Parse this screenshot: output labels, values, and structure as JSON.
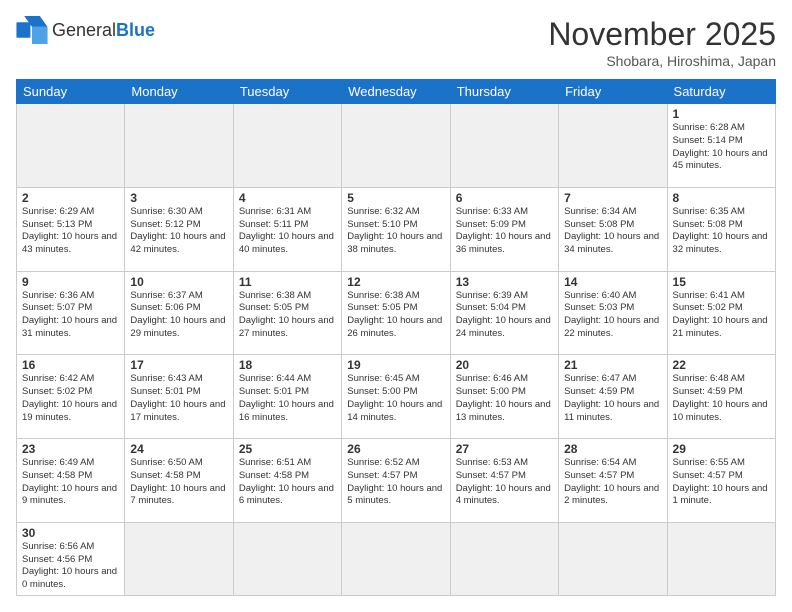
{
  "header": {
    "logo_general": "General",
    "logo_blue": "Blue",
    "month_title": "November 2025",
    "subtitle": "Shobara, Hiroshima, Japan"
  },
  "weekdays": [
    "Sunday",
    "Monday",
    "Tuesday",
    "Wednesday",
    "Thursday",
    "Friday",
    "Saturday"
  ],
  "rows": [
    [
      {
        "num": "",
        "info": ""
      },
      {
        "num": "",
        "info": ""
      },
      {
        "num": "",
        "info": ""
      },
      {
        "num": "",
        "info": ""
      },
      {
        "num": "",
        "info": ""
      },
      {
        "num": "",
        "info": ""
      },
      {
        "num": "1",
        "info": "Sunrise: 6:28 AM\nSunset: 5:14 PM\nDaylight: 10 hours and 45 minutes."
      }
    ],
    [
      {
        "num": "2",
        "info": "Sunrise: 6:29 AM\nSunset: 5:13 PM\nDaylight: 10 hours and 43 minutes."
      },
      {
        "num": "3",
        "info": "Sunrise: 6:30 AM\nSunset: 5:12 PM\nDaylight: 10 hours and 42 minutes."
      },
      {
        "num": "4",
        "info": "Sunrise: 6:31 AM\nSunset: 5:11 PM\nDaylight: 10 hours and 40 minutes."
      },
      {
        "num": "5",
        "info": "Sunrise: 6:32 AM\nSunset: 5:10 PM\nDaylight: 10 hours and 38 minutes."
      },
      {
        "num": "6",
        "info": "Sunrise: 6:33 AM\nSunset: 5:09 PM\nDaylight: 10 hours and 36 minutes."
      },
      {
        "num": "7",
        "info": "Sunrise: 6:34 AM\nSunset: 5:08 PM\nDaylight: 10 hours and 34 minutes."
      },
      {
        "num": "8",
        "info": "Sunrise: 6:35 AM\nSunset: 5:08 PM\nDaylight: 10 hours and 32 minutes."
      }
    ],
    [
      {
        "num": "9",
        "info": "Sunrise: 6:36 AM\nSunset: 5:07 PM\nDaylight: 10 hours and 31 minutes."
      },
      {
        "num": "10",
        "info": "Sunrise: 6:37 AM\nSunset: 5:06 PM\nDaylight: 10 hours and 29 minutes."
      },
      {
        "num": "11",
        "info": "Sunrise: 6:38 AM\nSunset: 5:05 PM\nDaylight: 10 hours and 27 minutes."
      },
      {
        "num": "12",
        "info": "Sunrise: 6:38 AM\nSunset: 5:05 PM\nDaylight: 10 hours and 26 minutes."
      },
      {
        "num": "13",
        "info": "Sunrise: 6:39 AM\nSunset: 5:04 PM\nDaylight: 10 hours and 24 minutes."
      },
      {
        "num": "14",
        "info": "Sunrise: 6:40 AM\nSunset: 5:03 PM\nDaylight: 10 hours and 22 minutes."
      },
      {
        "num": "15",
        "info": "Sunrise: 6:41 AM\nSunset: 5:02 PM\nDaylight: 10 hours and 21 minutes."
      }
    ],
    [
      {
        "num": "16",
        "info": "Sunrise: 6:42 AM\nSunset: 5:02 PM\nDaylight: 10 hours and 19 minutes."
      },
      {
        "num": "17",
        "info": "Sunrise: 6:43 AM\nSunset: 5:01 PM\nDaylight: 10 hours and 17 minutes."
      },
      {
        "num": "18",
        "info": "Sunrise: 6:44 AM\nSunset: 5:01 PM\nDaylight: 10 hours and 16 minutes."
      },
      {
        "num": "19",
        "info": "Sunrise: 6:45 AM\nSunset: 5:00 PM\nDaylight: 10 hours and 14 minutes."
      },
      {
        "num": "20",
        "info": "Sunrise: 6:46 AM\nSunset: 5:00 PM\nDaylight: 10 hours and 13 minutes."
      },
      {
        "num": "21",
        "info": "Sunrise: 6:47 AM\nSunset: 4:59 PM\nDaylight: 10 hours and 11 minutes."
      },
      {
        "num": "22",
        "info": "Sunrise: 6:48 AM\nSunset: 4:59 PM\nDaylight: 10 hours and 10 minutes."
      }
    ],
    [
      {
        "num": "23",
        "info": "Sunrise: 6:49 AM\nSunset: 4:58 PM\nDaylight: 10 hours and 9 minutes."
      },
      {
        "num": "24",
        "info": "Sunrise: 6:50 AM\nSunset: 4:58 PM\nDaylight: 10 hours and 7 minutes."
      },
      {
        "num": "25",
        "info": "Sunrise: 6:51 AM\nSunset: 4:58 PM\nDaylight: 10 hours and 6 minutes."
      },
      {
        "num": "26",
        "info": "Sunrise: 6:52 AM\nSunset: 4:57 PM\nDaylight: 10 hours and 5 minutes."
      },
      {
        "num": "27",
        "info": "Sunrise: 6:53 AM\nSunset: 4:57 PM\nDaylight: 10 hours and 4 minutes."
      },
      {
        "num": "28",
        "info": "Sunrise: 6:54 AM\nSunset: 4:57 PM\nDaylight: 10 hours and 2 minutes."
      },
      {
        "num": "29",
        "info": "Sunrise: 6:55 AM\nSunset: 4:57 PM\nDaylight: 10 hours and 1 minute."
      }
    ],
    [
      {
        "num": "30",
        "info": "Sunrise: 6:56 AM\nSunset: 4:56 PM\nDaylight: 10 hours and 0 minutes."
      },
      {
        "num": "",
        "info": ""
      },
      {
        "num": "",
        "info": ""
      },
      {
        "num": "",
        "info": ""
      },
      {
        "num": "",
        "info": ""
      },
      {
        "num": "",
        "info": ""
      },
      {
        "num": "",
        "info": ""
      }
    ]
  ]
}
